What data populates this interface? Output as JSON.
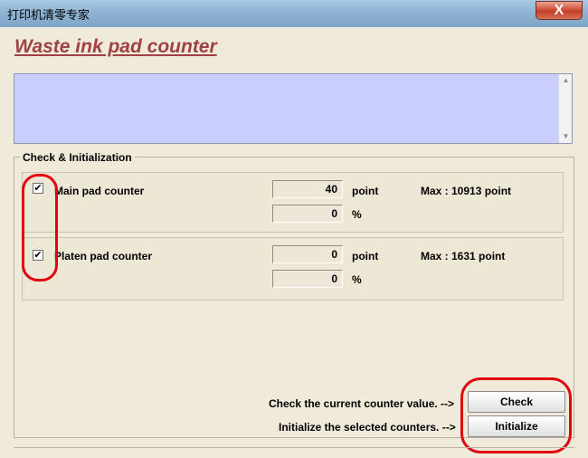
{
  "window": {
    "title": "打印机清零专家",
    "close_label": "X"
  },
  "heading": "Waste ink pad counter",
  "group": {
    "label": "Check & Initialization"
  },
  "counters": {
    "main": {
      "label": "Main pad counter",
      "checked": true,
      "point_value": "40",
      "point_unit": "point",
      "percent_value": "0",
      "percent_unit": "%",
      "max": "Max : 10913 point"
    },
    "platen": {
      "label": "Platen pad counter",
      "checked": true,
      "point_value": "0",
      "point_unit": "point",
      "percent_value": "0",
      "percent_unit": "%",
      "max": "Max : 1631 point"
    }
  },
  "actions": {
    "check_hint": "Check the current counter value. -->",
    "check_label": "Check",
    "init_hint": "Initialize the selected counters. -->",
    "init_label": "Initialize"
  },
  "icons": {
    "check_mark": "✔",
    "scroll_up": "▲",
    "scroll_down": "▼"
  },
  "colors": {
    "accent": "#a04242",
    "highlight": "#e4000f",
    "log_bg": "#c9ceff"
  }
}
